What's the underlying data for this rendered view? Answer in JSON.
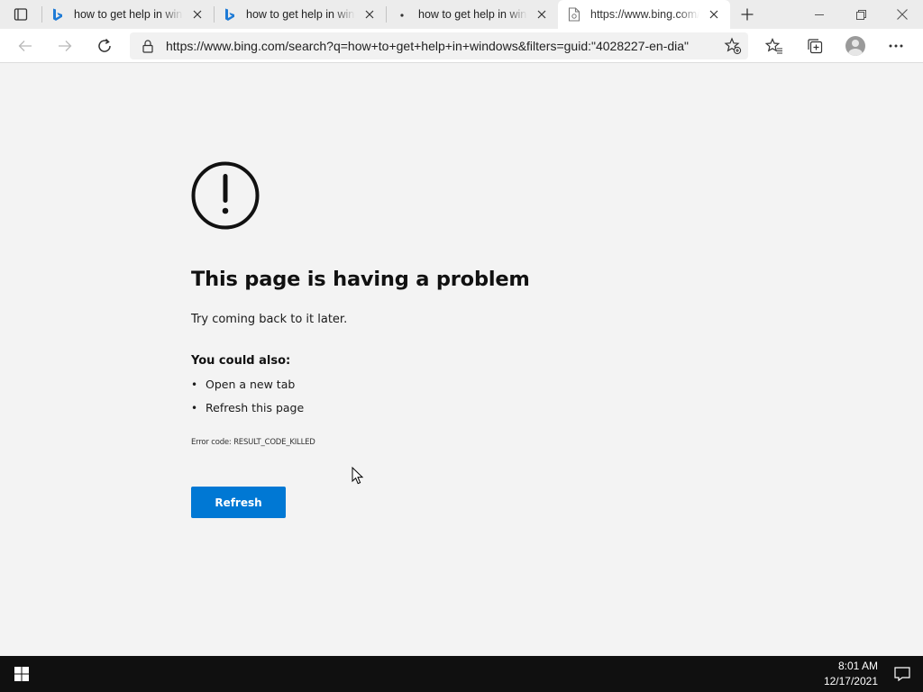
{
  "browser": {
    "tabs": [
      {
        "title": "how to get help in windows",
        "favicon": "bing-icon",
        "active": false
      },
      {
        "title": "how to get help in windows",
        "favicon": "bing-icon",
        "active": false
      },
      {
        "title": "how to get help in windows",
        "favicon": "loading-dot-icon",
        "active": false
      },
      {
        "title": "https://www.bing.com/search",
        "favicon": "error-page-icon",
        "active": true
      }
    ],
    "address_url": "https://www.bing.com/search?q=how+to+get+help+in+windows&filters=guid:\"4028227-en-dia\"",
    "accent_color": "#0078d4"
  },
  "error_page": {
    "title": "This page is having a problem",
    "subtitle": "Try coming back to it later.",
    "also_heading": "You could also:",
    "suggestions": [
      "Open a new tab",
      "Refresh this page"
    ],
    "error_code": "Error code: RESULT_CODE_KILLED",
    "refresh_label": "Refresh"
  },
  "taskbar": {
    "time": "8:01 AM",
    "date": "12/17/2021"
  }
}
